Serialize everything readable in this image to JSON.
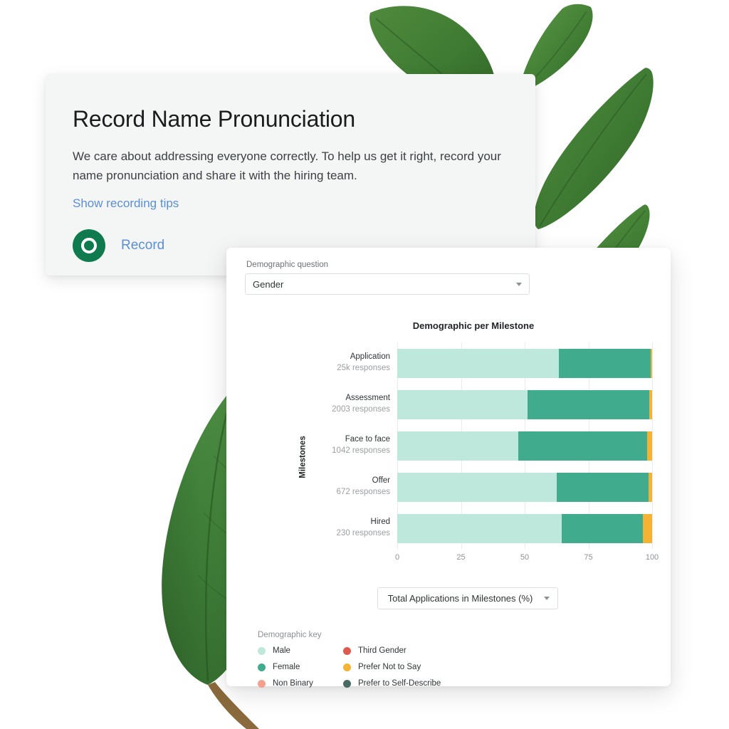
{
  "record_card": {
    "title": "Record Name Pronunciation",
    "body": "We care about addressing everyone correctly. To help us get it right, record your name pronunciation and share it with the hiring team.",
    "link_label": "Show recording tips",
    "record_button_label": "Record"
  },
  "chart_card": {
    "question_field_label": "Demographic question",
    "question_value": "Gender",
    "metric_value": "Total Applications in Milestones (%)",
    "legend_title": "Demographic key"
  },
  "chart_data": {
    "type": "bar",
    "title": "Demographic per Milestone",
    "xlabel": "",
    "ylabel": "Milestones",
    "orientation": "horizontal",
    "stacked": true,
    "stack_mode": "percent",
    "xlim": [
      0,
      100
    ],
    "xticks": [
      "0",
      "25",
      "50",
      "75",
      "100"
    ],
    "grid": true,
    "legend_position": "below",
    "categories": [
      "Application",
      "Assessment",
      "Face to face",
      "Offer",
      "Hired"
    ],
    "category_sublabels": [
      "25k responses",
      "2003 responses",
      "1042 responses",
      "672 responses",
      "230 responses"
    ],
    "series": [
      {
        "name": "Male",
        "color": "#bfe8dc",
        "values": [
          63.5,
          51.0,
          47.5,
          62.5,
          64.5
        ]
      },
      {
        "name": "Female",
        "color": "#41ab8e",
        "values": [
          36.0,
          48.0,
          50.5,
          36.0,
          32.0
        ]
      },
      {
        "name": "Non Binary",
        "color": "#f4a08c",
        "values": [
          0,
          0,
          0,
          0,
          0
        ]
      },
      {
        "name": "Third Gender",
        "color": "#e05b4f",
        "values": [
          0,
          0,
          0,
          0,
          0
        ]
      },
      {
        "name": "Prefer Not to Say",
        "color": "#f5b335",
        "values": [
          0.5,
          1.0,
          2.0,
          1.5,
          3.5
        ]
      },
      {
        "name": "Prefer to Self-Describe",
        "color": "#4a6b63",
        "values": [
          0,
          0,
          0,
          0,
          0
        ]
      }
    ],
    "legend": [
      {
        "label": "Male",
        "color": "#bfe8dc"
      },
      {
        "label": "Third Gender",
        "color": "#e05b4f"
      },
      {
        "label": "Female",
        "color": "#41ab8e"
      },
      {
        "label": "Prefer Not to Say",
        "color": "#f5b335"
      },
      {
        "label": "Non Binary",
        "color": "#f4a08c"
      },
      {
        "label": "Prefer to Self-Describe",
        "color": "#4a6b63"
      }
    ]
  }
}
